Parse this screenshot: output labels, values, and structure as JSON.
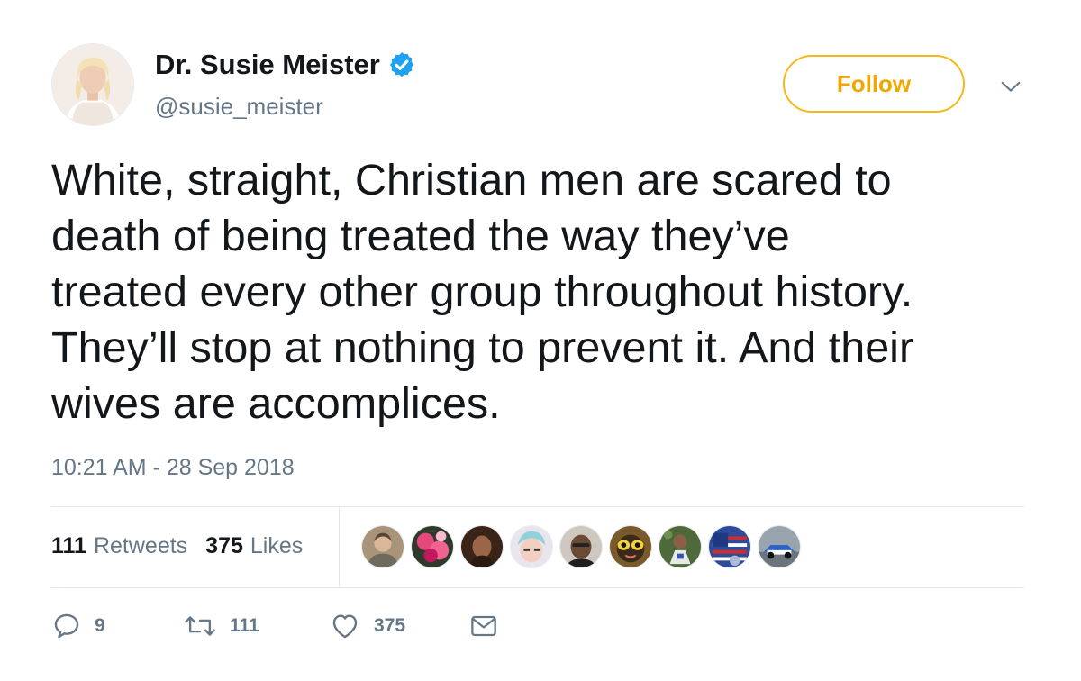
{
  "author": {
    "display_name": "Dr. Susie Meister",
    "handle": "@susie_meister",
    "verified": true
  },
  "follow_label": "Follow",
  "tweet": {
    "text": "White, straight, Christian men are scared to\ndeath of being treated the way they’ve\ntreated every other group throughout history.\nThey’ll stop at nothing to prevent it. And their\nwives are accomplices.",
    "timestamp": "10:21 AM - 28 Sep 2018"
  },
  "stats": {
    "retweets_count": "111",
    "retweets_label": "Retweets",
    "likes_count": "375",
    "likes_label": "Likes"
  },
  "actions": {
    "reply_count": "9",
    "retweet_count": "111",
    "like_count": "375"
  },
  "colors": {
    "follow_accent": "#f5b81b",
    "verified_badge": "#1da1f2",
    "muted_text": "#657786",
    "divider": "#e1e8ed"
  },
  "icons": [
    "verified-badge-icon",
    "chevron-down-icon",
    "reply-icon",
    "retweet-icon",
    "heart-icon",
    "mail-icon"
  ]
}
